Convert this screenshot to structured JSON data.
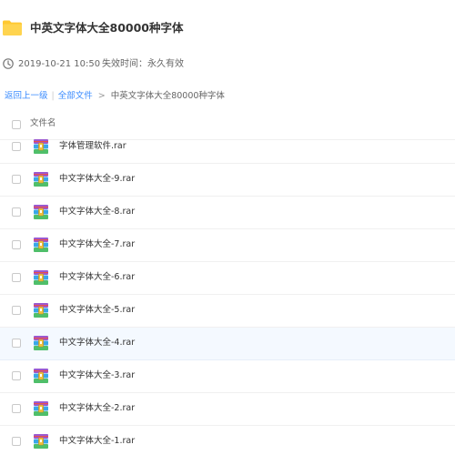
{
  "share": {
    "title": "中英文字体大全80000种字体",
    "date": "2019-10-21 10:50",
    "expire": "失效时间：永久有效"
  },
  "breadcrumb": {
    "back": "返回上一级",
    "separator": "|",
    "all_files": "全部文件",
    "arrow": ">",
    "current": "中英文字体大全80000种字体"
  },
  "table": {
    "header_label": "文件名",
    "files": [
      {
        "name": "字体管理软件.rar",
        "type": "rar-archive-icon"
      },
      {
        "name": "中文字体大全-9.rar",
        "type": "rar-archive-icon"
      },
      {
        "name": "中文字体大全-8.rar",
        "type": "rar-archive-icon"
      },
      {
        "name": "中文字体大全-7.rar",
        "type": "rar-archive-icon"
      },
      {
        "name": "中文字体大全-6.rar",
        "type": "rar-archive-icon"
      },
      {
        "name": "中文字体大全-5.rar",
        "type": "rar-archive-icon"
      },
      {
        "name": "中文字体大全-4.rar",
        "type": "rar-archive-icon"
      },
      {
        "name": "中文字体大全-3.rar",
        "type": "rar-archive-icon"
      },
      {
        "name": "中文字体大全-2.rar",
        "type": "rar-archive-icon"
      },
      {
        "name": "中文字体大全-1.rar",
        "type": "rar-archive-icon"
      }
    ]
  },
  "colors": {
    "link": "#3b8cff",
    "folder": "#ffc832",
    "hover_row": "#f4f9ff"
  }
}
